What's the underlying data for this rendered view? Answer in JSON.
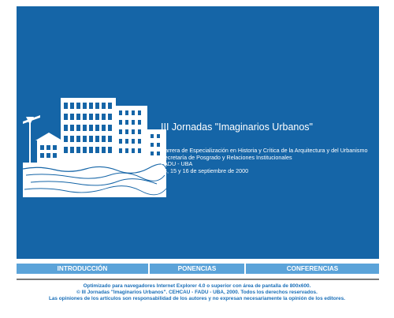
{
  "colors": {
    "hero_background": "#1565a7",
    "nav_background": "#5ba3d9",
    "footer_text": "#1a6fb8",
    "divider": "#7a7a7a"
  },
  "hero": {
    "title": "III Jornadas \"Imaginarios Urbanos\"",
    "info_lines": [
      "Carrera de Especialización en Historia y Crítica de la Arquitectura y del Urbanismo",
      "Secretaría de Posgrado y Relaciones Institucionales",
      "FADU - UBA",
      "14, 15 y 16 de septiembre de 2000"
    ],
    "artwork": "city-skyline-illustration"
  },
  "nav": {
    "items": [
      "INTRODUCCIÓN",
      "PONENCIAS",
      "CONFERENCIAS"
    ]
  },
  "footer": {
    "lines": [
      "Optimizado para navegadores Internet Explorer 4.0 o superior con área de pantalla de 800x600.",
      "© III Jornadas \"Imaginarios Urbanos\". CEHCAU - FADU - UBA, 2000. Todos los derechos reservados.",
      "Las opiniones de los artículos son responsabilidad de los autores y no expresan necesariamente la opinión de los editores."
    ]
  }
}
